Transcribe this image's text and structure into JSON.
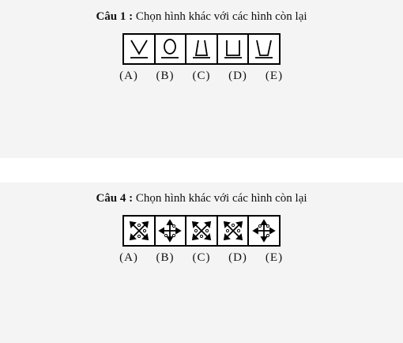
{
  "question1": {
    "number": "Câu 1 :",
    "prompt": "Chọn hình khác với các hình còn lại",
    "figures": [
      "v-shape",
      "o-shape",
      "trapezoid-shape",
      "u-square-shape",
      "cup-shape"
    ],
    "options": [
      "(A)",
      "(B)",
      "(C)",
      "(D)",
      "(E)"
    ]
  },
  "question4": {
    "number": "Câu 4 :",
    "prompt": "Chọn hình khác với các hình còn lại",
    "figures": [
      "x-arrows-dots",
      "plus-arrows-dots",
      "x-arrows-dots",
      "x-arrows-dots",
      "plus-arrows-dots"
    ],
    "options": [
      "(A)",
      "(B)",
      "(C)",
      "(D)",
      "(E)"
    ]
  }
}
